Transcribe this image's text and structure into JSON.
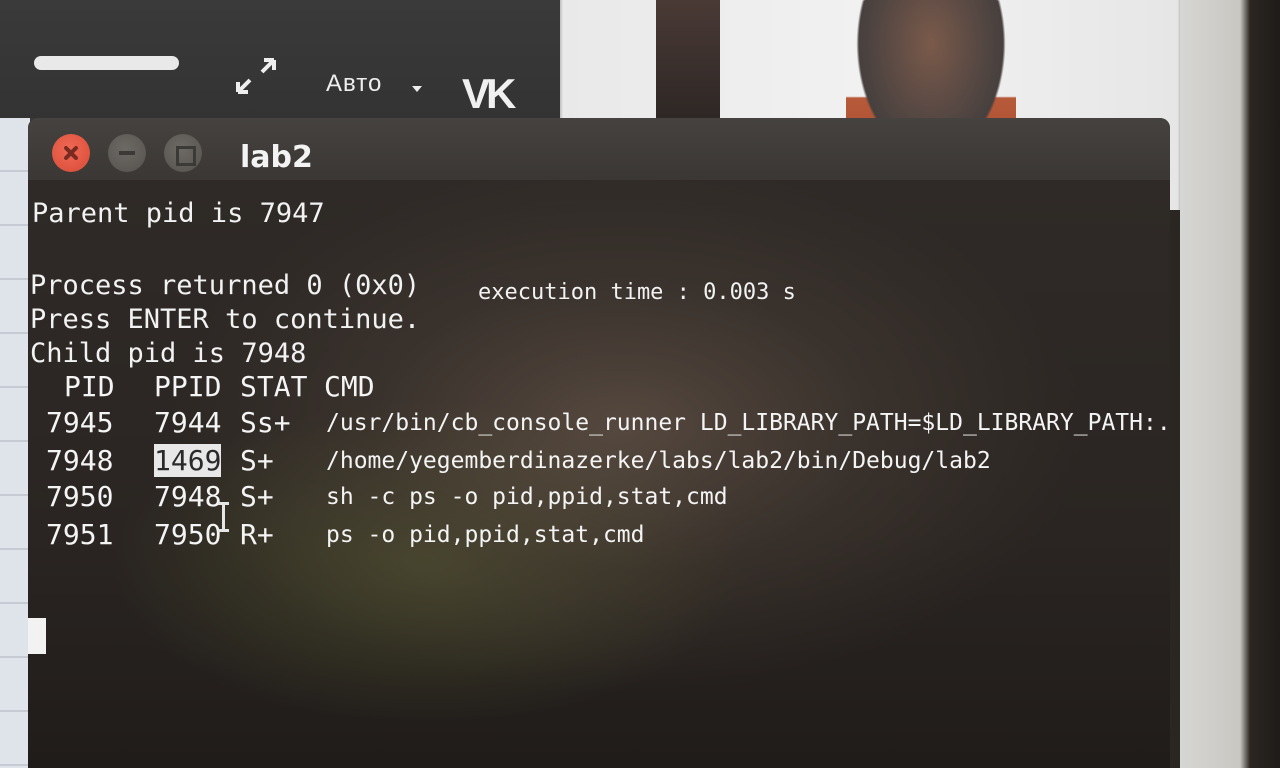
{
  "video_player": {
    "quality_label": "Авто",
    "logo_text": "VK"
  },
  "window": {
    "title": "lab2"
  },
  "terminal": {
    "lines": [
      "Parent pid is 7947",
      "Process returned 0 (0x0)",
      "execution time : 0.003 s",
      "Press ENTER to continue.",
      "Child pid is 7948"
    ],
    "ps_table": {
      "headers": [
        "PID",
        "PPID",
        "STAT",
        "CMD"
      ],
      "rows": [
        {
          "pid": "7945",
          "ppid": "7944",
          "stat": "Ss+",
          "cmd": "/usr/bin/cb_console_runner LD_LIBRARY_PATH=$LD_LIBRARY_PATH:. /"
        },
        {
          "pid": "7948",
          "ppid": "1469",
          "stat": "S+",
          "cmd": "/home/yegemberdinazerke/labs/lab2/bin/Debug/lab2"
        },
        {
          "pid": "7950",
          "ppid": "7948",
          "stat": "S+",
          "cmd": "sh -c ps -o pid,ppid,stat,cmd"
        },
        {
          "pid": "7951",
          "ppid": "7950",
          "stat": "R+",
          "cmd": "ps -o pid,ppid,stat,cmd"
        }
      ]
    }
  }
}
